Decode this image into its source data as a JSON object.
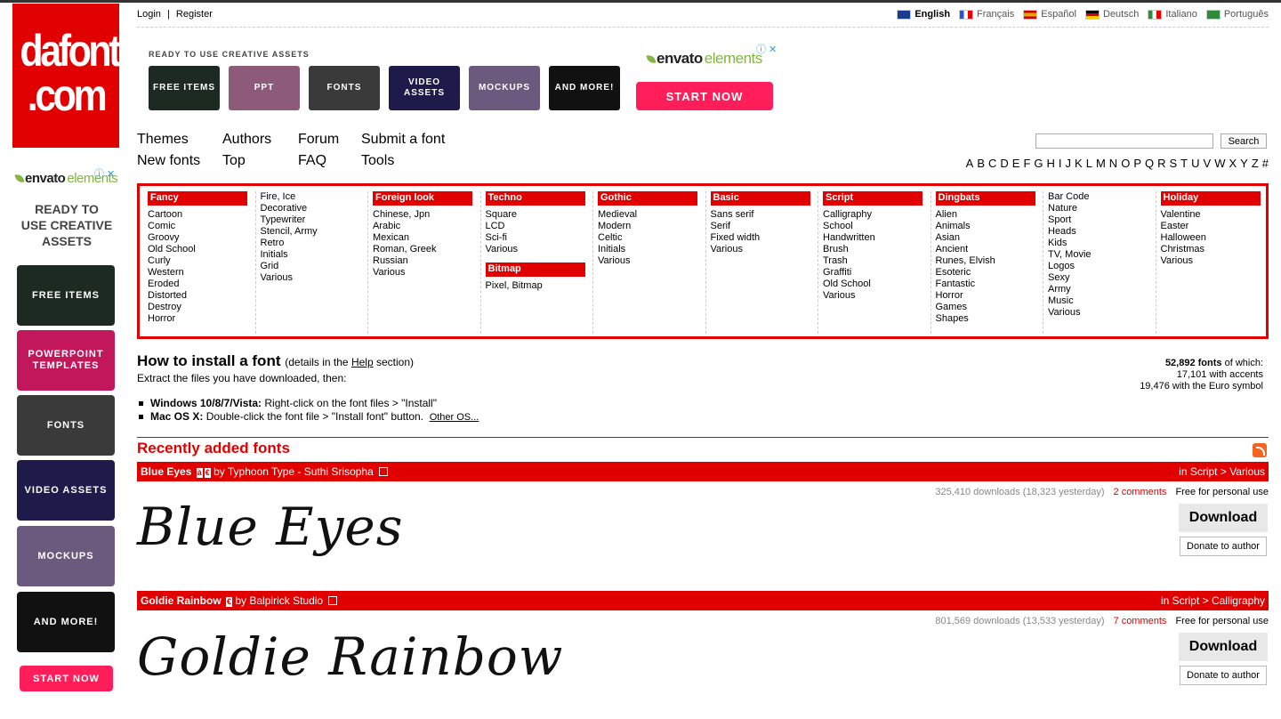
{
  "logo": {
    "line1": "dafont",
    "line2": ".com"
  },
  "auth": {
    "login": "Login",
    "separator": "|",
    "register": "Register"
  },
  "languages": [
    {
      "label": "English",
      "active": true,
      "color": "#1a3d8f"
    },
    {
      "label": "Français",
      "active": false,
      "color": "#2b55c7"
    },
    {
      "label": "Español",
      "active": false,
      "color": "#e0a800"
    },
    {
      "label": "Deutsch",
      "active": false,
      "color": "#b03030"
    },
    {
      "label": "Italiano",
      "active": false,
      "color": "#2e8b3a"
    },
    {
      "label": "Português",
      "active": false,
      "color": "#2e8b3a"
    }
  ],
  "top_ad": {
    "label": "READY TO USE CREATIVE ASSETS",
    "tiles": [
      "FREE ITEMS",
      "PPT",
      "FONTS",
      "VIDEO ASSETS",
      "MOCKUPS",
      "AND MORE!"
    ],
    "brand_main": "envato",
    "brand_sub": "elements",
    "cta": "START NOW"
  },
  "left_ad": {
    "brand_main": "envato",
    "brand_sub": "elements",
    "headline_1": "READY TO",
    "headline_2": "USE CREATIVE",
    "headline_3": "ASSETS",
    "tiles": [
      "FREE ITEMS",
      "POWERPOINT TEMPLATES",
      "FONTS",
      "VIDEO ASSETS",
      "MOCKUPS",
      "AND MORE!"
    ],
    "cta": "START NOW"
  },
  "nav": {
    "themes": "Themes",
    "new_fonts": "New fonts",
    "authors": "Authors",
    "top": "Top",
    "forum": "Forum",
    "faq": "FAQ",
    "submit": "Submit a font",
    "tools": "Tools"
  },
  "search": {
    "button": "Search",
    "value": ""
  },
  "alphabet": [
    "A",
    "B",
    "C",
    "D",
    "E",
    "F",
    "G",
    "H",
    "I",
    "J",
    "K",
    "L",
    "M",
    "N",
    "O",
    "P",
    "Q",
    "R",
    "S",
    "T",
    "U",
    "V",
    "W",
    "X",
    "Y",
    "Z",
    "#"
  ],
  "categories": [
    {
      "head": "Fancy",
      "items": [
        "Cartoon",
        "Comic",
        "Groovy",
        "Old School",
        "Curly",
        "Western",
        "Eroded",
        "Distorted",
        "Destroy",
        "Horror"
      ]
    },
    {
      "head": "",
      "items": [
        "Fire, Ice",
        "Decorative",
        "Typewriter",
        "Stencil, Army",
        "Retro",
        "Initials",
        "Grid",
        "Various"
      ]
    },
    {
      "head": "Foreign look",
      "items": [
        "Chinese, Jpn",
        "Arabic",
        "Mexican",
        "Roman, Greek",
        "Russian",
        "Various"
      ]
    },
    {
      "head": "Techno",
      "items": [
        "Square",
        "LCD",
        "Sci-fi",
        "Various"
      ],
      "head2": "Bitmap",
      "items2": [
        "Pixel, Bitmap"
      ]
    },
    {
      "head": "Gothic",
      "items": [
        "Medieval",
        "Modern",
        "Celtic",
        "Initials",
        "Various"
      ]
    },
    {
      "head": "Basic",
      "items": [
        "Sans serif",
        "Serif",
        "Fixed width",
        "Various"
      ]
    },
    {
      "head": "Script",
      "items": [
        "Calligraphy",
        "School",
        "Handwritten",
        "Brush",
        "Trash",
        "Graffiti",
        "Old School",
        "Various"
      ]
    },
    {
      "head": "Dingbats",
      "items": [
        "Alien",
        "Animals",
        "Asian",
        "Ancient",
        "Runes, Elvish",
        "Esoteric",
        "Fantastic",
        "Horror",
        "Games",
        "Shapes"
      ]
    },
    {
      "head": "",
      "items": [
        "Bar Code",
        "Nature",
        "Sport",
        "Heads",
        "Kids",
        "TV, Movie",
        "Logos",
        "Sexy",
        "Army",
        "Music",
        "Various"
      ]
    },
    {
      "head": "Holiday",
      "items": [
        "Valentine",
        "Easter",
        "Halloween",
        "Christmas",
        "Various"
      ]
    }
  ],
  "install": {
    "title": "How to install a font",
    "details_pre": "(details in the ",
    "details_link": "Help",
    "details_post": " section)",
    "subtitle": "Extract the files you have downloaded, then:",
    "windows_label": "Windows 10/8/7/Vista:",
    "windows_text": " Right-click on the font files > \"Install\"",
    "mac_label": "Mac OS X:",
    "mac_text": " Double-click the font file > \"Install font\" button.",
    "other": "Other OS..."
  },
  "stats": {
    "count": "52,892 fonts",
    "count_suffix": " of which:",
    "accents": "17,101 with accents",
    "euro": "19,476 with the Euro symbol"
  },
  "recent": {
    "title": "Recently added fonts"
  },
  "fonts": [
    {
      "name": "Blue Eyes",
      "badges": [
        "à",
        "€"
      ],
      "by": " by Typhoon Type - Suthi Srisopha",
      "category": "in Script > Various",
      "downloads": "325,410 downloads (18,323 yesterday)",
      "comments": "2 comments",
      "license": "Free for personal use",
      "download_label": "Download",
      "donate_label": "Donate to author",
      "preview": "Blue Eyes"
    },
    {
      "name": "Goldie Rainbow",
      "badges": [
        "€"
      ],
      "by": " by Balpirick Studio",
      "category": "in Script > Calligraphy",
      "downloads": "801,569 downloads (13,533 yesterday)",
      "comments": "7 comments",
      "license": "Free for personal use",
      "download_label": "Download",
      "donate_label": "Donate to author",
      "preview": "Goldie Rainbow"
    }
  ],
  "colors": {
    "brand_red": "#e00000",
    "cta_pink": "#ff1e5a",
    "envato_green": "#82b541"
  }
}
